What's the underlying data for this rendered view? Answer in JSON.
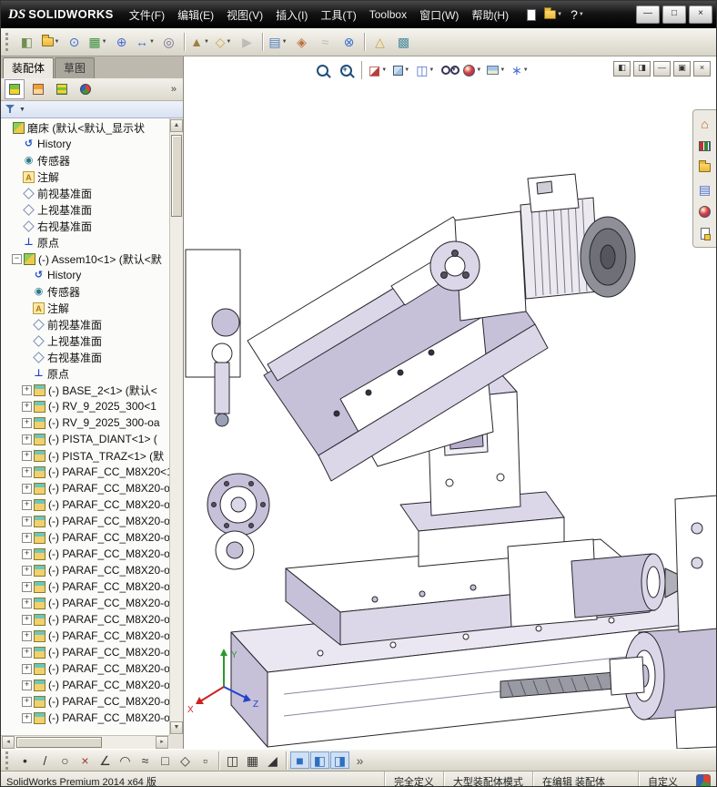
{
  "titlebar": {
    "logo_mark": "DS",
    "logo_text": "SOLIDWORKS",
    "menus": [
      {
        "name": "menu-file",
        "label": "文件(F)"
      },
      {
        "name": "menu-edit",
        "label": "编辑(E)"
      },
      {
        "name": "menu-view",
        "label": "视图(V)"
      },
      {
        "name": "menu-insert",
        "label": "插入(I)"
      },
      {
        "name": "menu-tools",
        "label": "工具(T)"
      },
      {
        "name": "menu-toolbox",
        "label": "Toolbox"
      },
      {
        "name": "menu-window",
        "label": "窗口(W)"
      },
      {
        "name": "menu-help",
        "label": "帮助(H)"
      }
    ],
    "quick_tools": [
      {
        "name": "new-document",
        "css": "mi-page"
      },
      {
        "name": "open-document",
        "css": "mi-folder",
        "dropdown": true
      },
      {
        "name": "help",
        "glyph": "?",
        "color": "#ffffff",
        "dropdown": true
      }
    ],
    "window_controls": [
      {
        "name": "minimize",
        "glyph": "—"
      },
      {
        "name": "maximize",
        "glyph": "□"
      },
      {
        "name": "close",
        "glyph": "×"
      }
    ]
  },
  "main_toolbar": {
    "buttons": [
      {
        "type": "grip"
      },
      {
        "name": "edit-component",
        "glyph": "◧",
        "color": "#6f8f4f"
      },
      {
        "name": "insert-components",
        "css": "mi-folder",
        "dropdown": true
      },
      {
        "name": "mate",
        "glyph": "⊙",
        "color": "#3a6fd0"
      },
      {
        "name": "linear-component-pattern",
        "glyph": "▦",
        "color": "#3f8f3f",
        "dropdown": true
      },
      {
        "name": "smart-fasteners",
        "glyph": "⊕",
        "color": "#4f6fd0"
      },
      {
        "name": "move-component",
        "glyph": "↔",
        "color": "#3a6fd0",
        "dropdown": true
      },
      {
        "name": "show-hidden-components",
        "glyph": "◎",
        "color": "#6f6f8f"
      },
      {
        "type": "sep"
      },
      {
        "name": "assembly-features",
        "glyph": "▲",
        "color": "#9f7f3f",
        "dropdown": true
      },
      {
        "name": "reference-geometry",
        "glyph": "◇",
        "color": "#caa83a",
        "dropdown": true
      },
      {
        "name": "new-motion-study",
        "glyph": "▶",
        "color": "#888888",
        "disabled": true
      },
      {
        "type": "sep"
      },
      {
        "name": "bill-of-materials",
        "glyph": "▤",
        "color": "#4f7fbf",
        "dropdown": true
      },
      {
        "name": "exploded-view",
        "glyph": "◈",
        "color": "#bf6f3f"
      },
      {
        "name": "explode-line-sketch",
        "glyph": "≈",
        "color": "#888888",
        "disabled": true
      },
      {
        "name": "interference-detection",
        "glyph": "⊗",
        "color": "#3a6fd0"
      },
      {
        "type": "sep"
      },
      {
        "name": "instant3d",
        "glyph": "△",
        "color": "#caa83a"
      },
      {
        "name": "large-assembly-mode",
        "glyph": "▩",
        "color": "#4f8f9f"
      }
    ]
  },
  "left_panel": {
    "tabs": [
      {
        "name": "tab-assembly",
        "label": "装配体",
        "active": true
      },
      {
        "name": "tab-sketch",
        "label": "草图",
        "active": false
      }
    ],
    "manager_tabs": [
      {
        "name": "featuremanager",
        "css": "fmi-tree",
        "active": true
      },
      {
        "name": "propertymanager",
        "css": "fmi-prop"
      },
      {
        "name": "configurationmanager",
        "css": "fmi-config"
      },
      {
        "name": "displaymanager",
        "css": "fmi-display"
      }
    ],
    "manager_expand": "»",
    "filter": {
      "dropdown": "▼"
    },
    "tree": {
      "items": [
        {
          "label": "磨床  (默认<默认_显示状",
          "icon": "assembly",
          "indent": 0
        },
        {
          "label": "History",
          "icon": "history",
          "indent": 1
        },
        {
          "label": "传感器",
          "icon": "sensors",
          "indent": 1
        },
        {
          "label": "注解",
          "icon": "annotations",
          "indent": 1
        },
        {
          "label": "前视基准面",
          "icon": "plane",
          "indent": 1
        },
        {
          "label": "上视基准面",
          "icon": "plane",
          "indent": 1
        },
        {
          "label": "右视基准面",
          "icon": "plane",
          "indent": 1
        },
        {
          "label": "原点",
          "icon": "origin",
          "indent": 1
        },
        {
          "label": "(-) Assem10<1> (默认<默",
          "icon": "assembly",
          "indent": 1,
          "expander": "minus"
        },
        {
          "label": "History",
          "icon": "history",
          "indent": 2
        },
        {
          "label": "传感器",
          "icon": "sensors",
          "indent": 2
        },
        {
          "label": "注解",
          "icon": "annotations",
          "indent": 2
        },
        {
          "label": "前视基准面",
          "icon": "plane",
          "indent": 2
        },
        {
          "label": "上视基准面",
          "icon": "plane",
          "indent": 2
        },
        {
          "label": "右视基准面",
          "icon": "plane",
          "indent": 2
        },
        {
          "label": "原点",
          "icon": "origin",
          "indent": 2
        },
        {
          "label": "(-) BASE_2<1> (默认<",
          "icon": "part",
          "indent": 2,
          "expander": "plus"
        },
        {
          "label": "(-) RV_9_2025_300<1",
          "icon": "part",
          "indent": 2,
          "expander": "plus"
        },
        {
          "label": "(-) RV_9_2025_300-oa",
          "icon": "part",
          "indent": 2,
          "expander": "plus"
        },
        {
          "label": "(-) PISTA_DIANT<1> (",
          "icon": "part",
          "indent": 2,
          "expander": "plus"
        },
        {
          "label": "(-) PISTA_TRAZ<1> (默",
          "icon": "part",
          "indent": 2,
          "expander": "plus"
        },
        {
          "label": "(-) PARAF_CC_M8X20<1",
          "icon": "part",
          "indent": 2,
          "expander": "plus"
        },
        {
          "label": "(-) PARAF_CC_M8X20-o",
          "icon": "part",
          "indent": 2,
          "expander": "plus"
        },
        {
          "label": "(-) PARAF_CC_M8X20-o",
          "icon": "part",
          "indent": 2,
          "expander": "plus"
        },
        {
          "label": "(-) PARAF_CC_M8X20-o",
          "icon": "part",
          "indent": 2,
          "expander": "plus"
        },
        {
          "label": "(-) PARAF_CC_M8X20-o",
          "icon": "part",
          "indent": 2,
          "expander": "plus"
        },
        {
          "label": "(-) PARAF_CC_M8X20-o",
          "icon": "part",
          "indent": 2,
          "expander": "plus"
        },
        {
          "label": "(-) PARAF_CC_M8X20-o",
          "icon": "part",
          "indent": 2,
          "expander": "plus"
        },
        {
          "label": "(-) PARAF_CC_M8X20-o",
          "icon": "part",
          "indent": 2,
          "expander": "plus"
        },
        {
          "label": "(-) PARAF_CC_M8X20-o",
          "icon": "part",
          "indent": 2,
          "expander": "plus"
        },
        {
          "label": "(-) PARAF_CC_M8X20-o",
          "icon": "part",
          "indent": 2,
          "expander": "plus"
        },
        {
          "label": "(-) PARAF_CC_M8X20-o",
          "icon": "part",
          "indent": 2,
          "expander": "plus"
        },
        {
          "label": "(-) PARAF_CC_M8X20-o",
          "icon": "part",
          "indent": 2,
          "expander": "plus"
        },
        {
          "label": "(-) PARAF_CC_M8X20-o",
          "icon": "part",
          "indent": 2,
          "expander": "plus"
        },
        {
          "label": "(-) PARAF_CC_M8X20-o",
          "icon": "part",
          "indent": 2,
          "expander": "plus"
        },
        {
          "label": "(-) PARAF_CC_M8X20-o",
          "icon": "part",
          "indent": 2,
          "expander": "plus"
        },
        {
          "label": "(-) PARAF_CC_M8X20-o",
          "icon": "part",
          "indent": 2,
          "expander": "plus"
        }
      ]
    }
  },
  "viewport": {
    "headsup_buttons": [
      {
        "name": "zoom-to-fit",
        "css": "mi-mag"
      },
      {
        "name": "zoom-to-area",
        "css": "mi-mag mi-magplus"
      },
      {
        "type": "sep"
      },
      {
        "name": "section-view",
        "glyph": "◪",
        "color": "#b53e3e",
        "dropdown": true
      },
      {
        "name": "view-orientation",
        "css": "mi-cube",
        "dropdown": true
      },
      {
        "name": "display-style",
        "glyph": "◫",
        "color": "#4f6fd0",
        "dropdown": true
      },
      {
        "name": "hide-show-items",
        "css": "mi-glasses",
        "dropdown": true
      },
      {
        "name": "edit-appearance",
        "css": "mi-ball",
        "dropdown": true
      },
      {
        "name": "apply-scene",
        "css": "mi-scene",
        "dropdown": true
      },
      {
        "name": "view-settings",
        "glyph": "∗",
        "color": "#4f6fd0",
        "dropdown": true
      }
    ],
    "document_controls": [
      {
        "name": "pane-left",
        "glyph": "◧"
      },
      {
        "name": "pane-right",
        "glyph": "◨"
      },
      {
        "name": "doc-minimize",
        "glyph": "—"
      },
      {
        "name": "doc-restore",
        "glyph": "▣"
      },
      {
        "name": "doc-close",
        "glyph": "×"
      }
    ],
    "task_pane": [
      {
        "name": "solidworks-resources",
        "glyph": "⌂",
        "color": "#c06020"
      },
      {
        "name": "design-library",
        "css": "mi-books"
      },
      {
        "name": "file-explorer",
        "css": "mi-folder"
      },
      {
        "name": "view-palette",
        "glyph": "▤",
        "color": "#4f6fd0"
      },
      {
        "name": "appearances-scenes",
        "css": "mi-ball"
      },
      {
        "name": "custom-properties",
        "css": "mi-props"
      }
    ],
    "triad": {
      "x": "X",
      "y": "Y",
      "z": "Z"
    }
  },
  "sketch_toolbar": {
    "buttons": [
      {
        "type": "grip"
      },
      {
        "name": "sketch-point",
        "glyph": "•",
        "color": "#333333"
      },
      {
        "name": "sketch-line",
        "glyph": "/",
        "color": "#333333"
      },
      {
        "name": "sketch-circle",
        "glyph": "○",
        "color": "#333333"
      },
      {
        "name": "sketch-erase",
        "glyph": "×",
        "color": "#a03030"
      },
      {
        "name": "sketch-angle-line",
        "glyph": "∠",
        "color": "#333333"
      },
      {
        "name": "sketch-arc",
        "glyph": "◠",
        "color": "#333333"
      },
      {
        "name": "sketch-spline",
        "glyph": "≈",
        "color": "#333333"
      },
      {
        "name": "sketch-rectangle",
        "glyph": "□",
        "color": "#333333"
      },
      {
        "name": "sketch-polygon",
        "glyph": "◇",
        "color": "#333333"
      },
      {
        "name": "sketch-trim",
        "glyph": "▫",
        "color": "#333333"
      },
      {
        "type": "sep"
      },
      {
        "name": "mirror-entities",
        "glyph": "◫",
        "color": "#333333"
      },
      {
        "name": "linear-sketch-pattern",
        "glyph": "▦",
        "color": "#333333"
      },
      {
        "name": "sketch-chamfer",
        "glyph": "◢",
        "color": "#333333"
      },
      {
        "type": "sep"
      },
      {
        "name": "shaded-view",
        "glyph": "■",
        "color": "#2d6fc0",
        "active": true
      },
      {
        "name": "two-pane-view",
        "glyph": "◧",
        "color": "#2d6fc0",
        "active": true
      },
      {
        "name": "split-view",
        "glyph": "◨",
        "color": "#2d6fc0",
        "active": true
      },
      {
        "name": "toolbar-options",
        "glyph": "»",
        "color": "#555555"
      }
    ]
  },
  "statusbar": {
    "app_info": "SolidWorks Premium 2014 x64 版",
    "cells": [
      {
        "name": "status-fully-defined",
        "label": "完全定义",
        "interactable": false
      },
      {
        "name": "status-large-assembly-mode",
        "label": "大型装配体模式",
        "interactable": false
      },
      {
        "name": "status-editing",
        "label": "在编辑 装配体",
        "interactable": false
      },
      {
        "name": "status-custom",
        "label": "自定义",
        "interactable": true,
        "gap_before": true
      }
    ]
  }
}
